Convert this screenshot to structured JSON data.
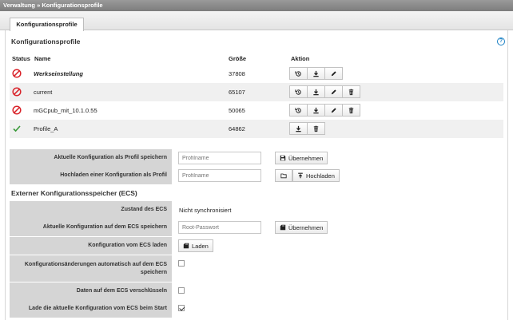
{
  "breadcrumb": "Verwaltung » Konfigurationsprofile",
  "tab": "Konfigurationsprofile",
  "profiles": {
    "title": "Konfigurationsprofile",
    "col_status": "Status",
    "col_name": "Name",
    "col_size": "Größe",
    "col_action": "Aktion",
    "rows": [
      {
        "status": "inactive",
        "name": "Werkseinstellung",
        "size": "37808"
      },
      {
        "status": "inactive",
        "name": "current",
        "size": "65107"
      },
      {
        "status": "inactive",
        "name": "mGCpub_mit_10.1.0.55",
        "size": "50065"
      },
      {
        "status": "active",
        "name": "Profile_A",
        "size": "64862"
      }
    ]
  },
  "save_profile": {
    "label": "Aktuelle Konfiguration als Profil speichern",
    "placeholder": "Profilname",
    "button": "Übernehmen"
  },
  "upload_profile": {
    "label": "Hochladen einer Konfiguration als Profil",
    "placeholder": "Profilname",
    "button": "Hochladen"
  },
  "ecs": {
    "title": "Externer Konfigurationsspeicher (ECS)",
    "state_label": "Zustand des ECS",
    "state_value": "Nicht synchronisiert",
    "save_label": "Aktuelle Konfiguration auf dem ECS speichern",
    "save_placeholder": "Root-Passwort",
    "save_button": "Übernehmen",
    "load_label": "Konfiguration vom ECS laden",
    "load_button": "Laden",
    "autosave_label": "Konfigurationsänderungen automatisch auf dem ECS speichern",
    "autosave_checked": false,
    "encrypt_label": "Daten auf dem ECS verschlüsseln",
    "encrypt_checked": false,
    "boot_label": "Lade die aktuelle Konfiguration vom ECS beim Start",
    "boot_checked": true
  },
  "colors": {
    "inactive": "#d9232a",
    "active": "#3a9a3a",
    "help": "#1a80c4"
  }
}
